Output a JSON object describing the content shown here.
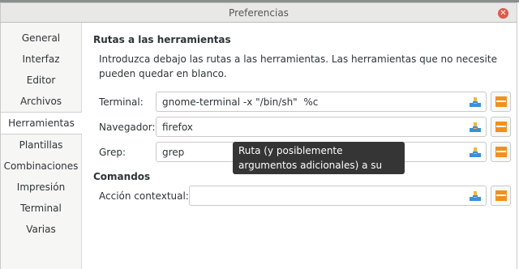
{
  "window": {
    "title": "Preferencias"
  },
  "sidebar": {
    "items": [
      {
        "label": "General"
      },
      {
        "label": "Interfaz"
      },
      {
        "label": "Editor"
      },
      {
        "label": "Archivos"
      },
      {
        "label": "Herramientas",
        "selected": true
      },
      {
        "label": "Plantillas"
      },
      {
        "label": "Combinaciones"
      },
      {
        "label": "Impresión"
      },
      {
        "label": "Terminal"
      },
      {
        "label": "Varias"
      }
    ]
  },
  "tools": {
    "section_title": "Rutas a las herramientas",
    "description": "Introduzca debajo las rutas a las herramientas. Las herramientas que no necesite pueden quedar en blanco.",
    "terminal": {
      "label": "Terminal:",
      "value": "gnome-terminal -x \"/bin/sh\"  %c"
    },
    "browser": {
      "label": "Navegador:",
      "value": "firefox"
    },
    "grep": {
      "label": "Grep:",
      "value": "grep"
    }
  },
  "commands": {
    "section_title": "Comandos",
    "context_action": {
      "label": "Acción contextual:",
      "value": ""
    }
  },
  "tooltip": {
    "text": "Ruta (y posiblemente argumentos adicionales) a su navegador favorito"
  },
  "colors": {
    "folder": "#f2901d",
    "clear_icon_blue": "#3b8fd9",
    "clear_icon_yellow": "#e8b84a"
  },
  "icons": {
    "clear": "edit-clear-icon",
    "open": "folder-open-icon",
    "close": "window-close-icon"
  }
}
